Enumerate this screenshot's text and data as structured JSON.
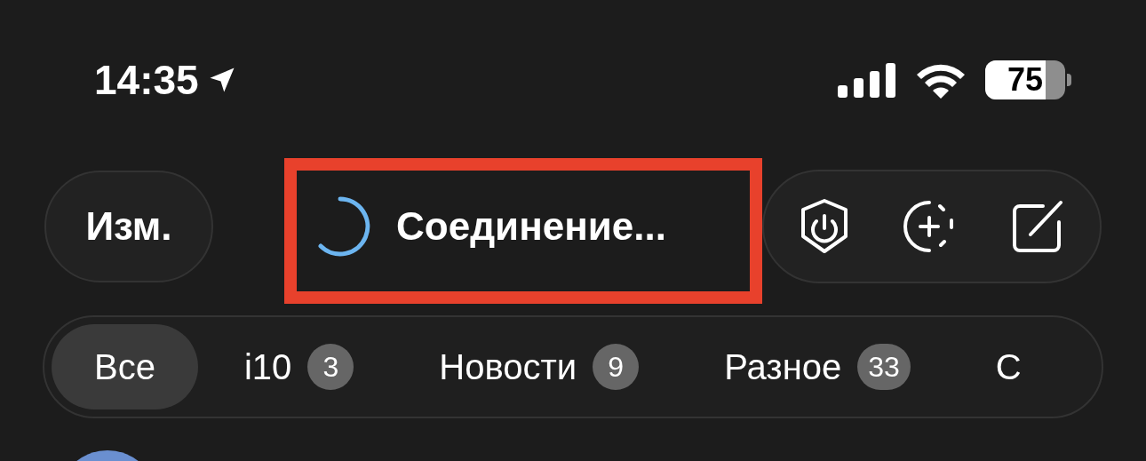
{
  "status_bar": {
    "time": "14:35",
    "battery": {
      "text": "75",
      "level": 0.75
    }
  },
  "header": {
    "edit_button": "Изм.",
    "title": "Соединение...",
    "loading": true,
    "highlighted": true
  },
  "tabs": [
    {
      "label": "Все",
      "selected": true
    },
    {
      "label": "i10",
      "count": "3",
      "selected": false
    },
    {
      "label": "Новости",
      "count": "9",
      "selected": false
    },
    {
      "label": "Разное",
      "count": "33",
      "selected": false
    },
    {
      "label": "С",
      "selected": false
    }
  ]
}
